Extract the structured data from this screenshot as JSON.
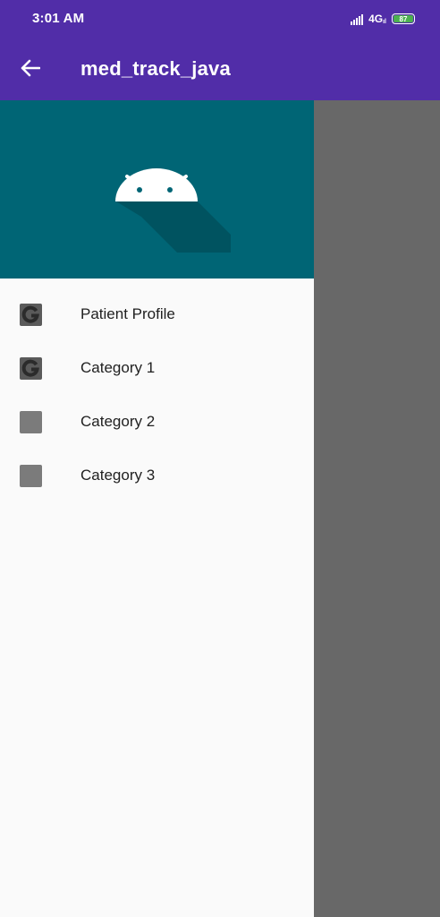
{
  "status_bar": {
    "time": "3:01 AM",
    "network": "4G",
    "battery_level": "87",
    "battery_color": "#4CAF50"
  },
  "app_bar": {
    "title": "med_track_java",
    "back_icon": "arrow-back-icon",
    "color": "#512DA8"
  },
  "drawer": {
    "header_color": "#006575",
    "header_icon": "android-icon",
    "items": [
      {
        "label": "Patient Profile",
        "icon": "google-icon"
      },
      {
        "label": "Category 1",
        "icon": "google-icon"
      },
      {
        "label": "Category 2",
        "icon": "square-icon"
      },
      {
        "label": "Category 3",
        "icon": "square-icon"
      }
    ]
  }
}
